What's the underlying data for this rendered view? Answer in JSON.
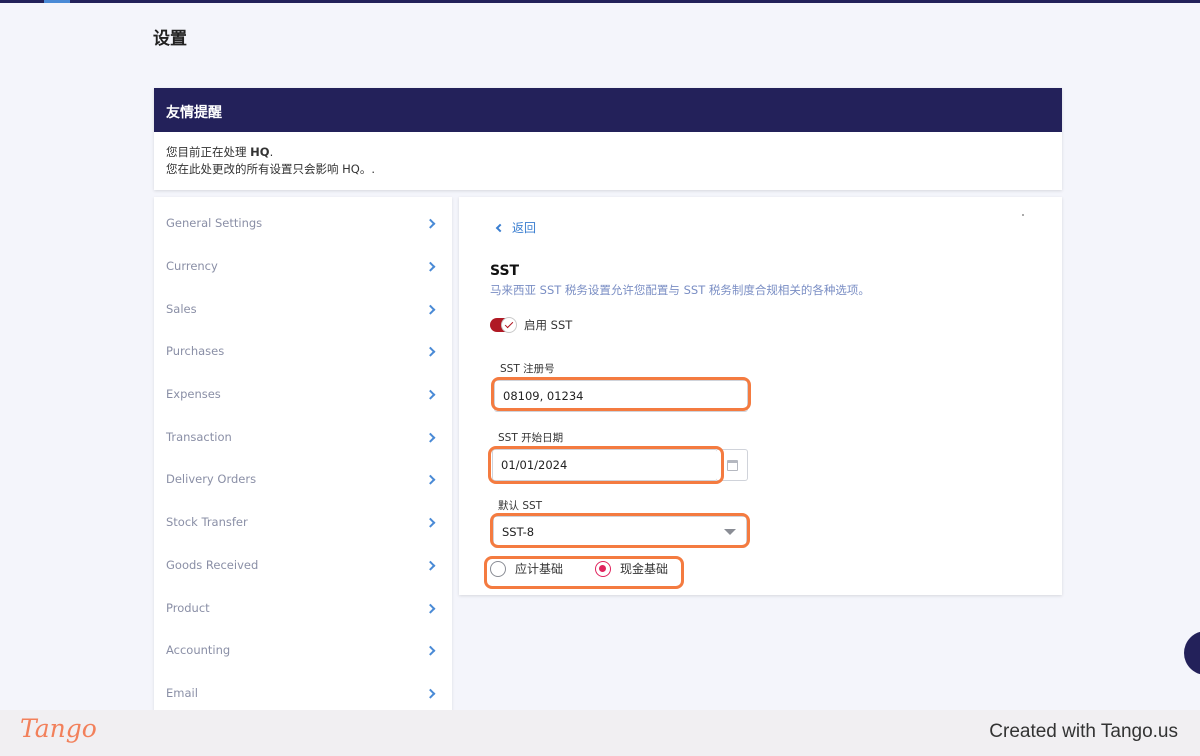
{
  "page": {
    "title": "设置"
  },
  "reminder": {
    "title": "友情提醒",
    "line1_prefix": "您目前正在处理 ",
    "line1_entity": "HQ",
    "line1_suffix": ".",
    "line2": "您在此处更改的所有设置只会影响 HQ。."
  },
  "sidebar": {
    "items": [
      {
        "label": "General Settings"
      },
      {
        "label": "Currency"
      },
      {
        "label": "Sales"
      },
      {
        "label": "Purchases"
      },
      {
        "label": "Expenses"
      },
      {
        "label": "Transaction"
      },
      {
        "label": "Delivery Orders"
      },
      {
        "label": "Stock Transfer"
      },
      {
        "label": "Goods Received"
      },
      {
        "label": "Product"
      },
      {
        "label": "Accounting"
      },
      {
        "label": "Email"
      }
    ]
  },
  "panel": {
    "back_label": "返回",
    "section_title": "SST",
    "section_desc": "马来西亚 SST 税务设置允许您配置与 SST 税务制度合规相关的各种选项。",
    "toggle_label": "启用 SST",
    "toggle_on": true,
    "reg_no": {
      "label": "SST 注册号",
      "value": "08109, 01234"
    },
    "start_date": {
      "label": "SST 开始日期",
      "value": "01/01/2024"
    },
    "default_sst": {
      "label": "默认 SST",
      "value": "SST-8"
    },
    "basis": {
      "options": [
        {
          "label": "应计基础",
          "selected": false
        },
        {
          "label": "现金基础",
          "selected": true
        }
      ]
    }
  },
  "footer": {
    "logo": "Tango",
    "credit": "Created with Tango.us"
  },
  "colors": {
    "brand_navy": "#23215a",
    "link_blue": "#3a7ed0",
    "highlight_orange": "#f47b40",
    "toggle_red": "#b01924",
    "radio_pink": "#e0245e"
  }
}
